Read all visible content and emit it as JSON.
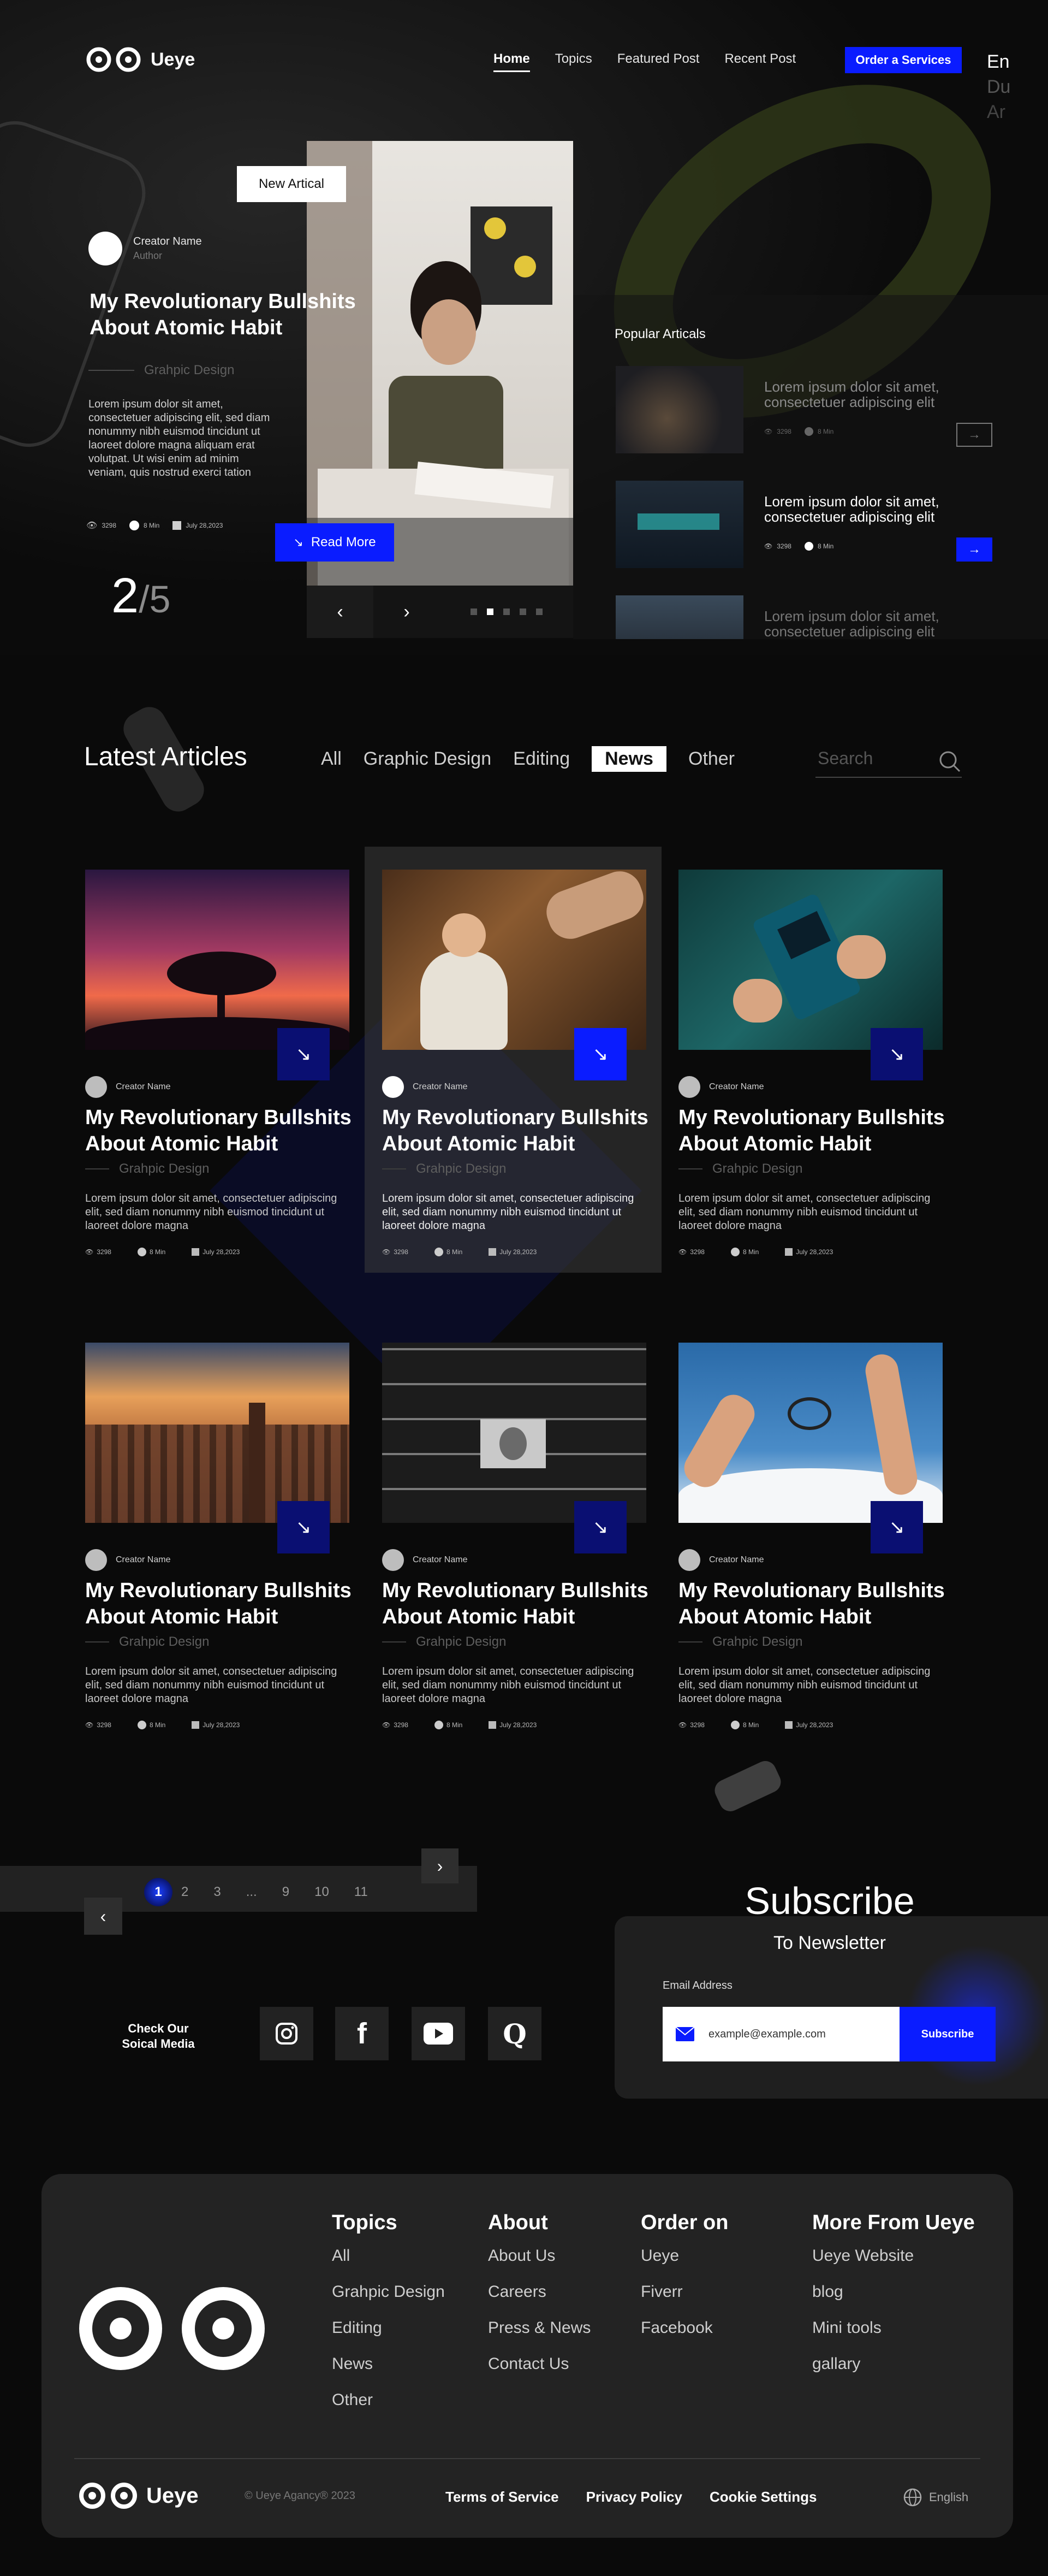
{
  "brand": {
    "name": "Ueye"
  },
  "nav": {
    "items": [
      "Home",
      "Topics",
      "Featured Post",
      "Recent Post"
    ],
    "cta": "Order a Services",
    "languages": [
      "En",
      "Du",
      "Ar"
    ]
  },
  "hero": {
    "badge": "New Artical",
    "creator_name": "Creator Name",
    "creator_role": "Author",
    "title": "My Revolutionary Bullshits About  Atomic Habit",
    "category": "Grahpic Design",
    "description": "Lorem ipsum dolor sit amet, consectetuer adipiscing elit, sed diam nonummy nibh euismod tincidunt ut laoreet dolore magna aliquam erat volutpat. Ut wisi enim ad minim veniam, quis nostrud exerci tation",
    "views": "3298",
    "read_time": "8 Min",
    "date": "July 28,2023",
    "read_more": "Read More",
    "slide_current": "2",
    "slide_total": "/5",
    "popular_title": "Popular Articals",
    "popular": [
      {
        "text": "Lorem ipsum dolor sit amet, consectetuer adipiscing elit",
        "views": "3298",
        "time": "8 Min"
      },
      {
        "text": "Lorem ipsum dolor sit amet, consectetuer adipiscing elit",
        "views": "3298",
        "time": "8 Min"
      },
      {
        "text": "Lorem ipsum dolor sit amet, consectetuer adipiscing elit"
      }
    ]
  },
  "latest": {
    "title": "Latest Articles",
    "filters": [
      "All",
      "Graphic Design",
      "Editing",
      "News",
      "Other"
    ],
    "active_filter": "News",
    "search_placeholder": "Search",
    "cards": [
      {
        "creator": "Creator Name",
        "title": "My Revolutionary Bullshits About  Atomic Habit",
        "category": "Grahpic Design",
        "description": "Lorem ipsum dolor sit amet, consectetuer adipiscing elit, sed diam nonummy nibh euismod tincidunt ut laoreet dolore magna",
        "views": "3298",
        "time": "8 Min",
        "date": "July 28,2023"
      },
      {
        "creator": "Creator Name",
        "title": "My Revolutionary Bullshits About  Atomic Habit",
        "category": "Grahpic Design",
        "description": "Lorem ipsum dolor sit amet, consectetuer adipiscing elit, sed diam nonummy nibh euismod tincidunt ut laoreet dolore magna",
        "views": "3298",
        "time": "8 Min",
        "date": "July 28,2023"
      },
      {
        "creator": "Creator Name",
        "title": "My Revolutionary Bullshits About  Atomic Habit",
        "category": "Grahpic Design",
        "description": "Lorem ipsum dolor sit amet, consectetuer adipiscing elit, sed diam nonummy nibh euismod tincidunt ut laoreet dolore magna",
        "views": "3298",
        "time": "8 Min",
        "date": "July 28,2023"
      },
      {
        "creator": "Creator Name",
        "title": "My Revolutionary Bullshits About  Atomic Habit",
        "category": "Grahpic Design",
        "description": "Lorem ipsum dolor sit amet, consectetuer adipiscing elit, sed diam nonummy nibh euismod tincidunt ut laoreet dolore magna",
        "views": "3298",
        "time": "8 Min",
        "date": "July 28,2023"
      },
      {
        "creator": "Creator Name",
        "title": "My Revolutionary Bullshits About  Atomic Habit",
        "category": "Grahpic Design",
        "description": "Lorem ipsum dolor sit amet, consectetuer adipiscing elit, sed diam nonummy nibh euismod tincidunt ut laoreet dolore magna",
        "views": "3298",
        "time": "8 Min",
        "date": "July 28,2023"
      },
      {
        "creator": "Creator Name",
        "title": "My Revolutionary Bullshits About  Atomic Habit",
        "category": "Grahpic Design",
        "description": "Lorem ipsum dolor sit amet, consectetuer adipiscing elit, sed diam nonummy nibh euismod tincidunt ut laoreet dolore magna",
        "views": "3298",
        "time": "8 Min",
        "date": "July 28,2023"
      }
    ]
  },
  "pagination": {
    "pages": [
      "1",
      "2",
      "3",
      "...",
      "9",
      "10",
      "11"
    ],
    "current": "1"
  },
  "social": {
    "label_line1": "Check Our",
    "label_line2": "Soical Media",
    "icons": [
      "instagram-icon",
      "facebook-icon",
      "youtube-icon",
      "quora-icon"
    ]
  },
  "subscribe": {
    "title": "Subscribe",
    "subtitle": "To Newsletter",
    "email_label": "Email Address",
    "placeholder": "example@example.com",
    "button": "Subscribe"
  },
  "footer": {
    "columns": [
      {
        "title": "Topics",
        "items": [
          "All",
          "Grahpic Design",
          "Editing",
          "News",
          "Other"
        ]
      },
      {
        "title": "About",
        "items": [
          "About Us",
          "Careers",
          "Press & News",
          "Contact Us"
        ]
      },
      {
        "title": "Order on",
        "items": [
          "Ueye",
          "Fiverr",
          "Facebook"
        ]
      },
      {
        "title": "More From Ueye",
        "items": [
          "Ueye Website",
          "blog",
          "Mini tools",
          "gallary"
        ]
      }
    ],
    "copyright": "© Ueye Agancy® 2023",
    "links": [
      "Terms of Service",
      "Privacy Policy",
      "Cookie Settings"
    ],
    "language": "English"
  },
  "colors": {
    "accent": "#0a1cff",
    "dark_accent": "#0a0f72",
    "background": "#0a0a0a"
  }
}
